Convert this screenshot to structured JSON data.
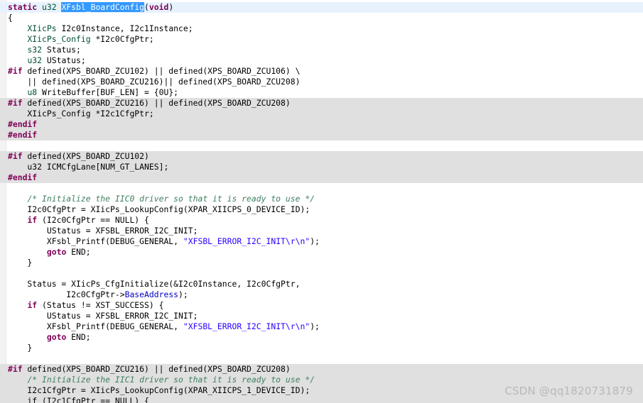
{
  "watermark": "CSDN @qq1820731879",
  "lines": [
    {
      "bg": "current",
      "t": [
        {
          "c": "kw",
          "v": "static"
        },
        {
          "v": " "
        },
        {
          "c": "ty",
          "v": "u32"
        },
        {
          "v": " "
        },
        {
          "c": "sel",
          "v": "XFsbl_BoardConfig"
        },
        {
          "v": "("
        },
        {
          "c": "kw",
          "v": "void"
        },
        {
          "v": ")"
        }
      ]
    },
    {
      "bg": "",
      "t": [
        {
          "v": "{"
        }
      ]
    },
    {
      "bg": "",
      "t": [
        {
          "v": "    "
        },
        {
          "c": "ty",
          "v": "XIicPs"
        },
        {
          "v": " I2c0Instance, I2c1Instance;"
        }
      ]
    },
    {
      "bg": "",
      "t": [
        {
          "v": "    "
        },
        {
          "c": "ty",
          "v": "XIicPs_Config"
        },
        {
          "v": " *I2c0CfgPtr;"
        }
      ]
    },
    {
      "bg": "",
      "t": [
        {
          "v": "    "
        },
        {
          "c": "ty",
          "v": "s32"
        },
        {
          "v": " Status;"
        }
      ]
    },
    {
      "bg": "",
      "t": [
        {
          "v": "    "
        },
        {
          "c": "ty",
          "v": "u32"
        },
        {
          "v": " UStatus;"
        }
      ]
    },
    {
      "bg": "",
      "t": [
        {
          "c": "pp",
          "v": "#if"
        },
        {
          "v": " defined(XPS_BOARD_ZCU102) || defined(XPS_BOARD_ZCU106) \\"
        }
      ]
    },
    {
      "bg": "",
      "t": [
        {
          "v": "    || defined(XPS_BOARD_ZCU216)|| defined(XPS_BOARD_ZCU208)"
        }
      ]
    },
    {
      "bg": "",
      "t": [
        {
          "v": "    "
        },
        {
          "c": "ty",
          "v": "u8"
        },
        {
          "v": " WriteBuffer[BUF_LEN] = {0U};"
        }
      ]
    },
    {
      "bg": "inactive",
      "t": [
        {
          "c": "pp",
          "v": "#if"
        },
        {
          "v": " defined(XPS_BOARD_ZCU216) || defined(XPS_BOARD_ZCU208)"
        }
      ]
    },
    {
      "bg": "inactive",
      "t": [
        {
          "v": "    XIicPs_Config *I2c1CfgPtr;"
        }
      ]
    },
    {
      "bg": "inactive",
      "t": [
        {
          "c": "pp",
          "v": "#endif"
        }
      ]
    },
    {
      "bg": "inactive",
      "t": [
        {
          "c": "pp",
          "v": "#endif"
        }
      ]
    },
    {
      "bg": "",
      "t": [
        {
          "v": ""
        }
      ]
    },
    {
      "bg": "inactive",
      "t": [
        {
          "c": "pp",
          "v": "#if"
        },
        {
          "v": " defined(XPS_BOARD_ZCU102)"
        }
      ]
    },
    {
      "bg": "inactive",
      "t": [
        {
          "v": "    u32 ICMCfgLane[NUM_GT_LANES];"
        }
      ]
    },
    {
      "bg": "inactive",
      "t": [
        {
          "c": "pp",
          "v": "#endif"
        }
      ]
    },
    {
      "bg": "",
      "t": [
        {
          "v": ""
        }
      ]
    },
    {
      "bg": "",
      "t": [
        {
          "v": "    "
        },
        {
          "c": "cm",
          "v": "/* Initialize the IIC0 driver so that it is ready to use */"
        }
      ]
    },
    {
      "bg": "",
      "t": [
        {
          "v": "    I2c0CfgPtr = XIicPs_LookupConfig(XPAR_XIICPS_0_DEVICE_ID);"
        }
      ]
    },
    {
      "bg": "",
      "t": [
        {
          "v": "    "
        },
        {
          "c": "kw",
          "v": "if"
        },
        {
          "v": " (I2c0CfgPtr == NULL) {"
        }
      ]
    },
    {
      "bg": "",
      "t": [
        {
          "v": "        UStatus = XFSBL_ERROR_I2C_INIT;"
        }
      ]
    },
    {
      "bg": "",
      "t": [
        {
          "v": "        XFsbl_Printf(DEBUG_GENERAL, "
        },
        {
          "c": "st",
          "v": "\"XFSBL_ERROR_I2C_INIT\\r\\n\""
        },
        {
          "v": ");"
        }
      ]
    },
    {
      "bg": "",
      "t": [
        {
          "v": "        "
        },
        {
          "c": "kw",
          "v": "goto"
        },
        {
          "v": " END;"
        }
      ]
    },
    {
      "bg": "",
      "t": [
        {
          "v": "    }"
        }
      ]
    },
    {
      "bg": "",
      "t": [
        {
          "v": ""
        }
      ]
    },
    {
      "bg": "",
      "t": [
        {
          "v": "    Status = XIicPs_CfgInitialize(&I2c0Instance, I2c0CfgPtr,"
        }
      ]
    },
    {
      "bg": "",
      "t": [
        {
          "v": "            I2c0CfgPtr->"
        },
        {
          "c": "fld",
          "v": "BaseAddress"
        },
        {
          "v": ");"
        }
      ]
    },
    {
      "bg": "",
      "t": [
        {
          "v": "    "
        },
        {
          "c": "kw",
          "v": "if"
        },
        {
          "v": " (Status != XST_SUCCESS) {"
        }
      ]
    },
    {
      "bg": "",
      "t": [
        {
          "v": "        UStatus = XFSBL_ERROR_I2C_INIT;"
        }
      ]
    },
    {
      "bg": "",
      "t": [
        {
          "v": "        XFsbl_Printf(DEBUG_GENERAL, "
        },
        {
          "c": "st",
          "v": "\"XFSBL_ERROR_I2C_INIT\\r\\n\""
        },
        {
          "v": ");"
        }
      ]
    },
    {
      "bg": "",
      "t": [
        {
          "v": "        "
        },
        {
          "c": "kw",
          "v": "goto"
        },
        {
          "v": " END;"
        }
      ]
    },
    {
      "bg": "",
      "t": [
        {
          "v": "    }"
        }
      ]
    },
    {
      "bg": "",
      "t": [
        {
          "v": ""
        }
      ]
    },
    {
      "bg": "inactive",
      "t": [
        {
          "c": "pp",
          "v": "#if"
        },
        {
          "v": " defined(XPS_BOARD_ZCU216) || defined(XPS_BOARD_ZCU208)"
        }
      ]
    },
    {
      "bg": "inactive",
      "t": [
        {
          "v": "    "
        },
        {
          "c": "cm",
          "v": "/* Initialize the IIC1 driver so that it is ready to use */"
        }
      ]
    },
    {
      "bg": "inactive",
      "t": [
        {
          "v": "    I2c1CfgPtr = XIicPs_LookupConfig(XPAR_XIICPS_1_DEVICE_ID);"
        }
      ]
    },
    {
      "bg": "inactive",
      "t": [
        {
          "v": "    if (I2c1CfgPtr == NULL) {"
        }
      ]
    }
  ]
}
